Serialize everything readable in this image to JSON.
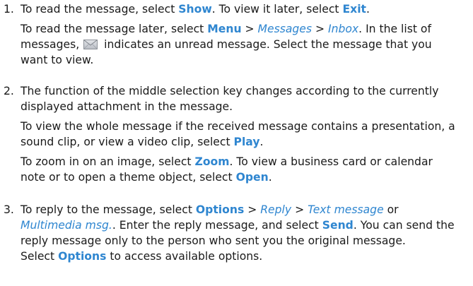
{
  "steps": [
    {
      "number": "1.",
      "p1": {
        "a": "To read the message, select ",
        "b": "Show",
        "c": ". To view it later, select ",
        "d": "Exit",
        "e": "."
      },
      "p2": {
        "a": "To read the message later, select ",
        "b": "Menu",
        "c": " > ",
        "d": "Messages",
        "e": " > ",
        "f": "Inbox",
        "g": ". In the list of",
        "h": "messages,",
        "icon": "unread-message-envelope-icon",
        "i": "indicates an unread message. Select the message that you",
        "j": "want to view."
      }
    },
    {
      "number": "2.",
      "p1": {
        "a": "The function of the middle selection key changes according to the currently",
        "b": "displayed attachment in the message."
      },
      "p2": {
        "a": "To view the whole message if the received message contains a presentation, a",
        "b": "sound clip, or view a video clip, select ",
        "c": "Play",
        "d": "."
      },
      "p3": {
        "a": "To zoom in on an image, select ",
        "b": "Zoom",
        "c": ". To view a business card or calendar",
        "d": "note or to open a theme object, select ",
        "e": "Open",
        "f": "."
      }
    },
    {
      "number": "3.",
      "p1": {
        "a": "To reply to the message, select ",
        "b": "Options",
        "c": " > ",
        "d": "Reply",
        "e": " > ",
        "f": "Text message",
        "g": " or",
        "h": "Multimedia msg.",
        "i": ". Enter the reply message, and select ",
        "j": "Send",
        "k": ". You can send the",
        "l": "reply message only to the person who sent you the original message."
      },
      "p2": {
        "a": "Select ",
        "b": "Options",
        "c": " to access available options."
      }
    }
  ]
}
